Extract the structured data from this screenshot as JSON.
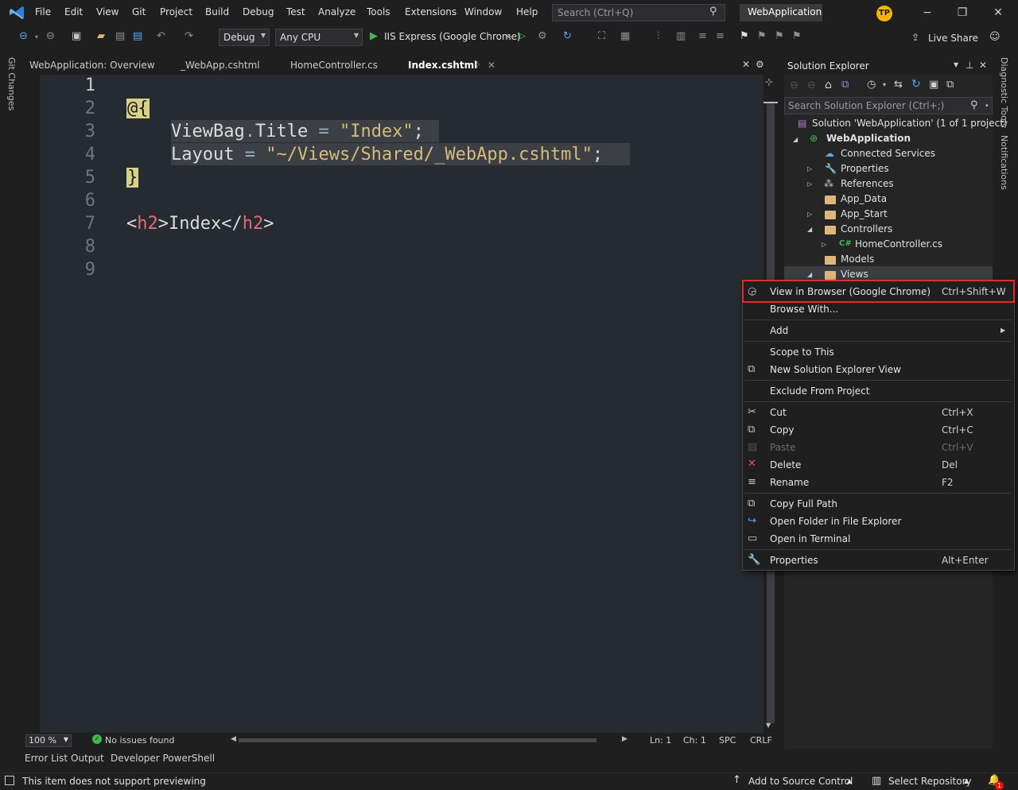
{
  "menu": {
    "items": [
      "File",
      "Edit",
      "View",
      "Git",
      "Project",
      "Build",
      "Debug",
      "Test",
      "Analyze",
      "Tools",
      "Extensions",
      "Window",
      "Help"
    ],
    "search_placeholder": "Search (Ctrl+Q)",
    "app_name": "WebApplication",
    "avatar_initials": "TP"
  },
  "toolbar": {
    "config": "Debug",
    "platform": "Any CPU",
    "run_target": "IIS Express (Google Chrome)",
    "live_share": "Live Share"
  },
  "left_strip": {
    "git_changes": "Git Changes"
  },
  "tabs": [
    {
      "label": "WebApplication: Overview"
    },
    {
      "label": "_WebApp.cshtml"
    },
    {
      "label": "HomeController.cs"
    },
    {
      "label": "Index.cshtml"
    }
  ],
  "editor": {
    "line_numbers": [
      "1",
      "2",
      "3",
      "4",
      "5",
      "6",
      "7",
      "8",
      "9"
    ],
    "code": {
      "open": "@{",
      "viewbag": "ViewBag",
      "dot": ".",
      "title_prop": "Title",
      "eq": " = ",
      "title_value": "\"Index\"",
      "semi": ";",
      "layout": "Layout",
      "layout_value": "\"~/Views/Shared/_WebApp.cshtml\"",
      "close": "}",
      "lt": "<",
      "h2": "h2",
      "gt": ">",
      "index_text": "Index",
      "lt_close": "</"
    }
  },
  "editor_status": {
    "zoom": "100 %",
    "issues": "No issues found",
    "ln": "Ln: 1",
    "ch": "Ch: 1",
    "spc": "SPC",
    "crlf": "CRLF"
  },
  "bottom_tabs": [
    "Error List",
    "Output",
    "Developer PowerShell"
  ],
  "status_bar": {
    "message": "This item does not support previewing",
    "add_source": "Add to Source Control",
    "select_repo": "Select Repository",
    "notif_count": "1"
  },
  "solution_explorer": {
    "title": "Solution Explorer",
    "search_placeholder": "Search Solution Explorer (Ctrl+;)",
    "solution_label": "Solution 'WebApplication' (1 of 1 project)",
    "project": "WebApplication",
    "items": [
      {
        "label": "Connected Services"
      },
      {
        "label": "Properties"
      },
      {
        "label": "References"
      },
      {
        "label": "App_Data"
      },
      {
        "label": "App_Start"
      },
      {
        "label": "Controllers"
      },
      {
        "label": "HomeController.cs"
      },
      {
        "label": "Models"
      },
      {
        "label": "Views"
      }
    ],
    "csharp_badge": "C#"
  },
  "right_labels": {
    "diagnostic_tools": "Diagnostic Tools",
    "notifications": "Notifications"
  },
  "context_menu": {
    "items": [
      {
        "label": "View in Browser (Google Chrome)",
        "shortcut": "Ctrl+Shift+W"
      },
      {
        "label": "Browse With...",
        "shortcut": ""
      },
      {
        "label": "Add",
        "shortcut": ""
      },
      {
        "label": "Scope to This",
        "shortcut": ""
      },
      {
        "label": "New Solution Explorer View",
        "shortcut": ""
      },
      {
        "label": "Exclude From Project",
        "shortcut": ""
      },
      {
        "label": "Cut",
        "shortcut": "Ctrl+X"
      },
      {
        "label": "Copy",
        "shortcut": "Ctrl+C"
      },
      {
        "label": "Paste",
        "shortcut": "Ctrl+V"
      },
      {
        "label": "Delete",
        "shortcut": "Del"
      },
      {
        "label": "Rename",
        "shortcut": "F2"
      },
      {
        "label": "Copy Full Path",
        "shortcut": ""
      },
      {
        "label": "Open Folder in File Explorer",
        "shortcut": ""
      },
      {
        "label": "Open in Terminal",
        "shortcut": ""
      },
      {
        "label": "Properties",
        "shortcut": "Alt+Enter"
      }
    ]
  },
  "colors": {
    "highlight_border": "#e02b2b",
    "accent": "#007acc",
    "folder": "#dcb67a"
  }
}
